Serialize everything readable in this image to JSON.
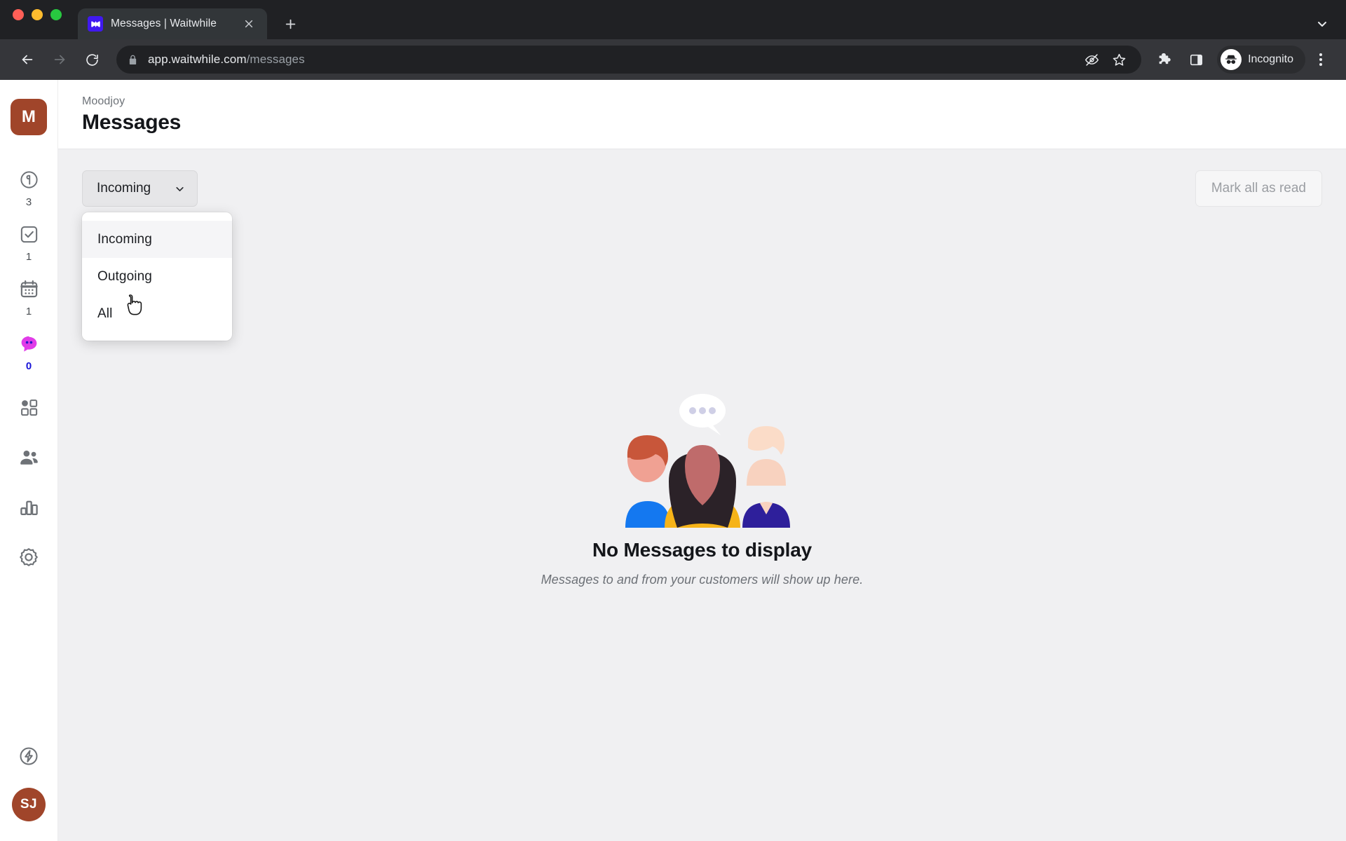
{
  "browser": {
    "tab": {
      "title": "Messages | Waitwhile",
      "favicon_icon": "waitwhile-logo-icon",
      "close_icon": "close-icon"
    },
    "new_tab_icon": "plus-icon",
    "tab_list_chevron_icon": "chevron-down-icon",
    "nav": {
      "back_icon": "back-arrow-icon",
      "forward_icon": "forward-arrow-icon",
      "reload_icon": "reload-icon"
    },
    "omnibox": {
      "lock_icon": "lock-icon",
      "url_host": "app.waitwhile.com",
      "url_path": "/messages",
      "hide_icon": "eye-slash-icon",
      "bookmark_icon": "star-icon"
    },
    "extensions_icon": "puzzle-piece-icon",
    "side_panel_icon": "side-panel-icon",
    "profile": {
      "label": "Incognito",
      "icon": "incognito-icon"
    },
    "menu_icon": "kebab-menu-icon"
  },
  "sidebar": {
    "org_initial": "M",
    "items": [
      {
        "name": "waitlist",
        "icon": "clock-icon",
        "badge": "3",
        "active": false
      },
      {
        "name": "checked-in",
        "icon": "check-square-icon",
        "badge": "1",
        "active": false
      },
      {
        "name": "bookings",
        "icon": "calendar-icon",
        "badge": "1",
        "active": false
      },
      {
        "name": "messages",
        "icon": "chat-bubble-icon",
        "badge": "0",
        "active": true
      },
      {
        "name": "services",
        "icon": "grid-icon",
        "badge": "",
        "active": false
      },
      {
        "name": "customers",
        "icon": "people-icon",
        "badge": "",
        "active": false
      },
      {
        "name": "analytics",
        "icon": "bar-chart-icon",
        "badge": "",
        "active": false
      },
      {
        "name": "settings",
        "icon": "gear-icon",
        "badge": "",
        "active": false
      }
    ],
    "bolt_icon": "lightning-bolt-icon",
    "user_initials": "SJ"
  },
  "header": {
    "breadcrumb": "Moodjoy",
    "title": "Messages"
  },
  "toolbar": {
    "filter_selected": "Incoming",
    "filter_chevron_icon": "chevron-down-icon",
    "mark_all_read_label": "Mark all as read"
  },
  "dropdown": {
    "open": true,
    "options": [
      {
        "label": "Incoming",
        "hovered": true
      },
      {
        "label": "Outgoing",
        "hovered": false
      },
      {
        "label": "All",
        "hovered": false
      }
    ]
  },
  "empty_state": {
    "illustration": "three-people-with-speech-bubble-illustration",
    "title": "No Messages to display",
    "subtitle": "Messages to and from your customers will show up here."
  },
  "colors": {
    "org_brown": "#a0452a",
    "active_magenta": "#e13ce8",
    "badge_blue": "#1a15d8",
    "favicon_violet": "#4019f0",
    "content_bg": "#f0f0f2"
  }
}
